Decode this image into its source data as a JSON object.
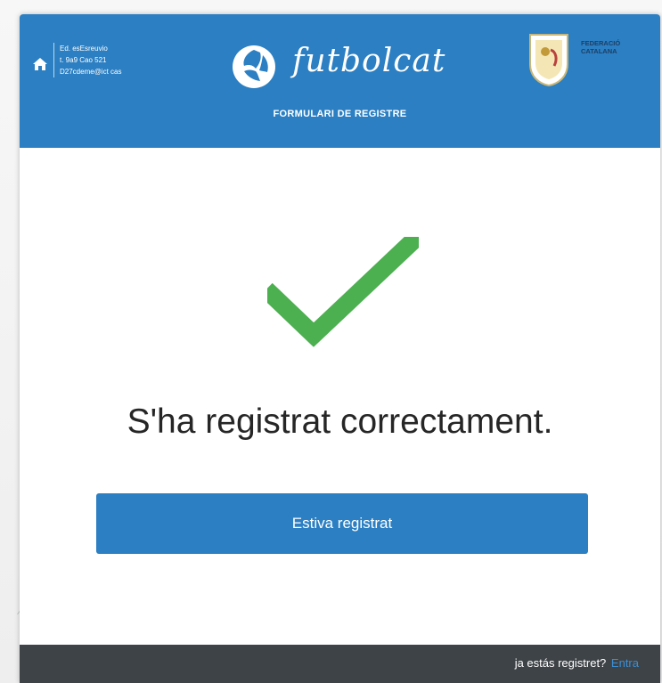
{
  "header": {
    "contact": {
      "line1": "Ed. esEsreuvio",
      "line2": "t. 9a9 Cao 521",
      "line3": "D27cdeme@ict cas"
    },
    "logo_text": "futbolcat",
    "subtitle": "FORMULARI DE REGISTRE",
    "federation_line1": "FEDERACIÓ",
    "federation_line2": "CATALANA"
  },
  "main": {
    "message": "S'ha registrat correctament.",
    "button_label": "Estiva registrat"
  },
  "footer": {
    "text": "ja estás registret?",
    "link_label": "Entra"
  },
  "colors": {
    "header_blue": "#2b7fc2",
    "check_green": "#4caf50",
    "footer_dark": "#3e4347",
    "link_blue": "#3b8fd4"
  },
  "icons": {
    "home": "home-icon",
    "logo": "football-logo-icon",
    "crest": "federation-crest-icon",
    "success": "checkmark-icon"
  }
}
